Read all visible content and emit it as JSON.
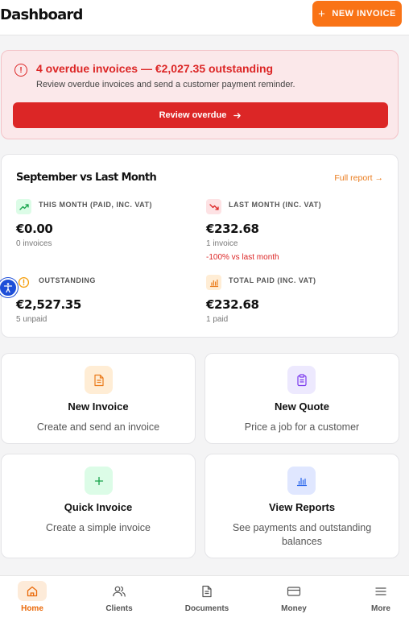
{
  "header": {
    "title": "Dashboard",
    "new_invoice_label": "NEW INVOICE"
  },
  "alert": {
    "title": "4 overdue invoices — €2,027.35 outstanding",
    "text": "Review overdue invoices and send a customer payment reminder.",
    "button_label": "Review overdue"
  },
  "stats": {
    "title": "September vs Last Month",
    "full_report_label": "Full report",
    "this_month": {
      "label": "THIS MONTH (PAID, INC. VAT)",
      "value": "€0.00",
      "sub": "0 invoices"
    },
    "last_month": {
      "label": "LAST MONTH (INC. VAT)",
      "value": "€232.68",
      "sub": "1 invoice",
      "delta": "-100% vs last month"
    },
    "outstanding": {
      "label": "OUTSTANDING",
      "value": "€2,527.35",
      "sub": "5 unpaid"
    },
    "total_paid": {
      "label": "TOTAL PAID (INC. VAT)",
      "value": "€232.68",
      "sub": "1 paid"
    }
  },
  "actions": {
    "new_invoice": {
      "title": "New Invoice",
      "subtitle": "Create and send an invoice",
      "icon": "invoice-icon"
    },
    "new_quote": {
      "title": "New Quote",
      "subtitle": "Price a job for a customer",
      "icon": "quote-icon"
    },
    "quick_invoice": {
      "title": "Quick Invoice",
      "subtitle": "Create a simple invoice",
      "icon": "plus-icon"
    },
    "view_reports": {
      "title": "View Reports",
      "subtitle": "See payments and outstanding balances",
      "icon": "bar-chart-icon"
    }
  },
  "nav": {
    "home": "Home",
    "clients": "Clients",
    "documents": "Documents",
    "money": "Money",
    "more": "More",
    "active": "home"
  },
  "colors": {
    "accent": "#f97316",
    "danger": "#dc2626",
    "alert_bg": "#fbe8ea",
    "success": "#16a34a",
    "quote_purple": "#7c3aed",
    "report_blue": "#2563eb"
  }
}
